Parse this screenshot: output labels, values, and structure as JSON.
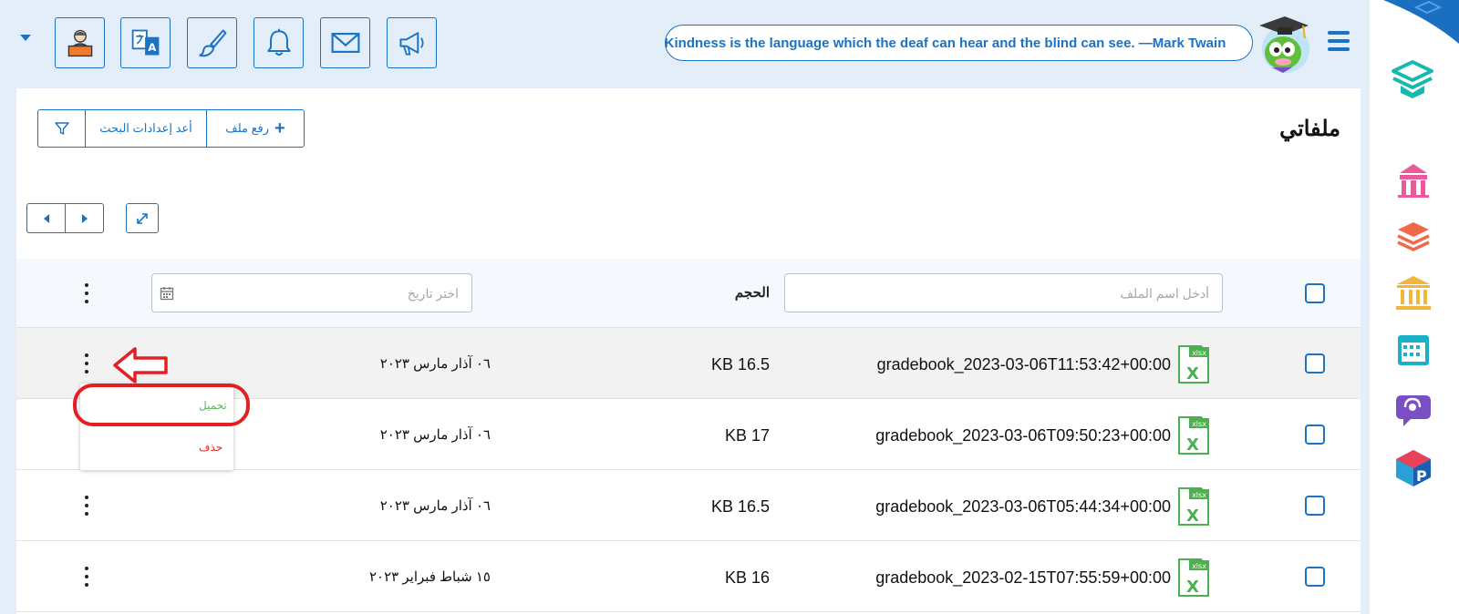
{
  "header": {
    "quote": "Kindness is the language which the deaf can hear and the blind can see. —Mark Twain"
  },
  "page": {
    "title": "ملفاتي"
  },
  "toolbar": {
    "upload_label": "رفع ملف",
    "upload_plus": "+",
    "reset_label": "أعد إعدادات البحث"
  },
  "table": {
    "name_placeholder": "أدخل اسم الملف",
    "date_placeholder": "اختر تاريخ",
    "size_header": "الحجم",
    "rows": [
      {
        "name": "gradebook_2023-03-06T11:53:42+00:00",
        "size": "KB 16.5",
        "date": "٠٦ آذار مارس ٢٠٢٣",
        "icon_text": "xlsx"
      },
      {
        "name": "gradebook_2023-03-06T09:50:23+00:00",
        "size": "KB 17",
        "date": "٠٦ آذار مارس ٢٠٢٣",
        "icon_text": "xlsx"
      },
      {
        "name": "gradebook_2023-03-06T05:44:34+00:00",
        "size": "KB 16.5",
        "date": "٠٦ آذار مارس ٢٠٢٣",
        "icon_text": "xlsx"
      },
      {
        "name": "gradebook_2023-02-15T07:55:59+00:00",
        "size": "KB 16",
        "date": "١٥ شباط فبراير ٢٠٢٣",
        "icon_text": "xlsx"
      }
    ]
  },
  "row_menu": {
    "download_label": "تحميل",
    "delete_label": "حذف"
  },
  "colors": {
    "accent": "#1a73c4",
    "download": "#5cb85c",
    "delete": "#e0302c",
    "annotation": "#e22024"
  }
}
